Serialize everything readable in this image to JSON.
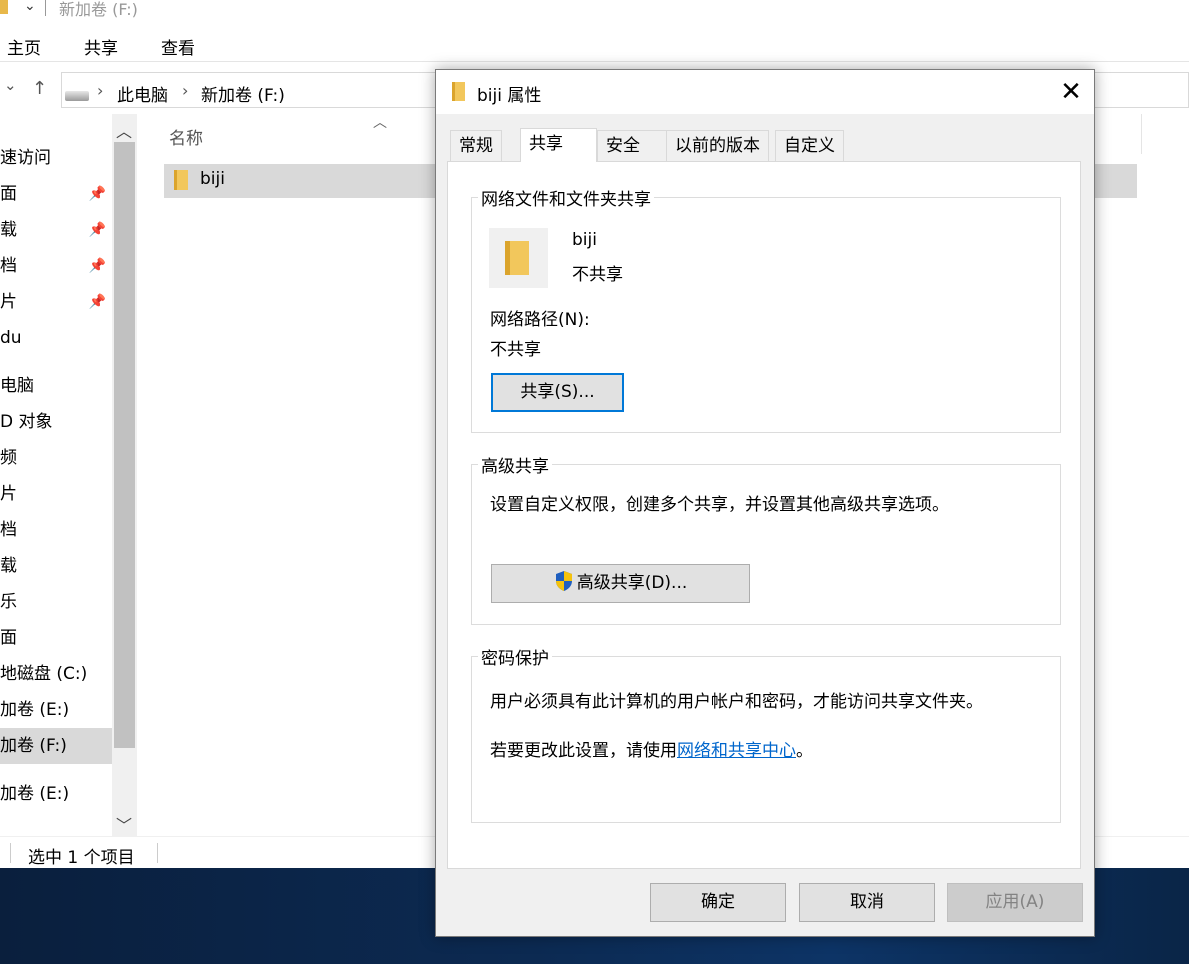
{
  "explorer": {
    "title": "新加卷 (F:)",
    "ribbon_tabs": [
      "主页",
      "共享",
      "查看"
    ],
    "breadcrumb": [
      "此电脑",
      "新加卷 (F:)"
    ],
    "nav_items": [
      {
        "label": "速访问",
        "pinned": false
      },
      {
        "label": "面",
        "pinned": true
      },
      {
        "label": "载",
        "pinned": true
      },
      {
        "label": "档",
        "pinned": true
      },
      {
        "label": "片",
        "pinned": true
      },
      {
        "label": "du",
        "pinned": false
      },
      {
        "label": "电脑",
        "pinned": false
      },
      {
        "label": "D 对象",
        "pinned": false
      },
      {
        "label": "频",
        "pinned": false
      },
      {
        "label": "片",
        "pinned": false
      },
      {
        "label": "档",
        "pinned": false
      },
      {
        "label": "载",
        "pinned": false
      },
      {
        "label": "乐",
        "pinned": false
      },
      {
        "label": "面",
        "pinned": false
      },
      {
        "label": "地磁盘 (C:)",
        "pinned": false
      },
      {
        "label": "加卷 (E:)",
        "pinned": false
      },
      {
        "label": "加卷 (F:)",
        "pinned": false,
        "selected": true
      },
      {
        "label": "加卷 (E:)",
        "pinned": false
      }
    ],
    "column_header": "名称",
    "files": [
      {
        "name": "biji",
        "type": "folder",
        "selected": true
      }
    ],
    "status": "选中 1 个项目"
  },
  "dialog": {
    "title": "biji 属性",
    "close_glyph": "✕",
    "tabs": [
      "常规",
      "共享",
      "安全",
      "以前的版本",
      "自定义"
    ],
    "active_tab": "共享",
    "network_sharing": {
      "group_label": "网络文件和文件夹共享",
      "folder_name": "biji",
      "share_status": "不共享",
      "network_path_label": "网络路径(N):",
      "network_path_value": "不共享",
      "share_button": "共享(S)..."
    },
    "advanced_sharing": {
      "group_label": "高级共享",
      "description": "设置自定义权限，创建多个共享，并设置其他高级共享选项。",
      "button": "高级共享(D)..."
    },
    "password_protection": {
      "group_label": "密码保护",
      "description": "用户必须具有此计算机的用户帐户和密码，才能访问共享文件夹。",
      "change_prefix": "若要更改此设置，请使用",
      "link": "网络和共享中心",
      "change_suffix": "。"
    },
    "buttons": {
      "ok": "确定",
      "cancel": "取消",
      "apply": "应用(A)"
    }
  },
  "colors": {
    "accent": "#0078d7",
    "selection": "#d9d9d9",
    "folder": "#f2c75c",
    "link": "#0066cc",
    "desktop": "#0c2a52"
  }
}
